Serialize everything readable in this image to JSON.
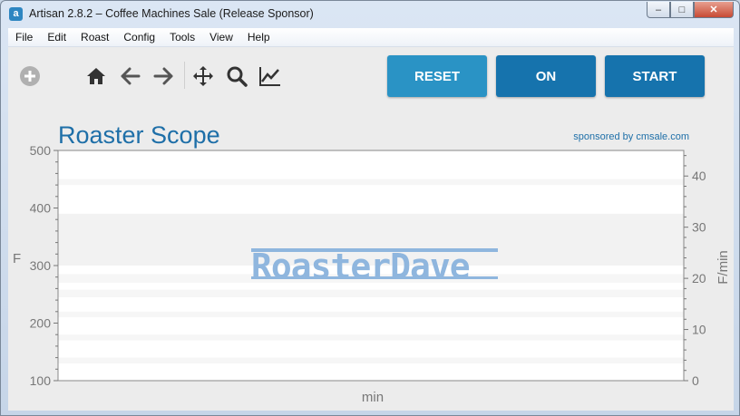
{
  "window": {
    "title": "Artisan 2.8.2 – Coffee Machines Sale (Release Sponsor)",
    "icon": "a",
    "controls": {
      "minimize": "–",
      "maximize": "□",
      "close": "✕"
    }
  },
  "menu": [
    "File",
    "Edit",
    "Roast",
    "Config",
    "Tools",
    "View",
    "Help"
  ],
  "toolbar": {
    "icons": [
      "add-icon",
      "home-icon",
      "back-arrow-icon",
      "forward-arrow-icon",
      "move-icon",
      "zoom-icon",
      "line-chart-icon"
    ]
  },
  "buttons": {
    "reset": "RESET",
    "on": "ON",
    "start": "START"
  },
  "chart": {
    "title": "Roaster Scope",
    "sponsor": "sponsored by cmsale.com",
    "watermark": "RoasterDave",
    "ylabel_left": "F",
    "ylabel_right": "F/min",
    "xlabel": "min",
    "accent": "#1e6fa8"
  },
  "chart_data": {
    "type": "line",
    "title": "Roaster Scope",
    "xlabel": "min",
    "ylabel": "F",
    "ylabel_right": "F/min",
    "ylim": [
      100,
      500
    ],
    "ylim_right": [
      0,
      45
    ],
    "yticks_left": [
      100,
      200,
      300,
      400,
      500
    ],
    "yticks_right": [
      0,
      10,
      20,
      30,
      40
    ],
    "series": [],
    "grid": true
  }
}
